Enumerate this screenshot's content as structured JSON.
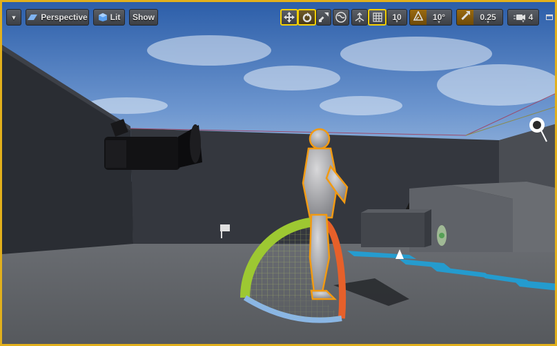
{
  "toolbar": {
    "menu_label": "▾",
    "perspective_label": "Perspective",
    "lit_label": "Lit",
    "show_label": "Show",
    "grid_snap_value": "10",
    "rotation_snap_value": "10°",
    "scale_snap_value": "0.25",
    "camera_speed_value": "4",
    "dropdown_arrow": "▾"
  },
  "colors": {
    "selection_border": "#e2b01c",
    "active_tool_border": "#f5d000",
    "snap_active": "#9a6a10"
  },
  "icons": {
    "menu": "chevron-down-icon",
    "perspective": "perspective-icon",
    "lit": "lit-sphere-icon",
    "translate": "translate-icon",
    "rotate": "rotate-icon",
    "scale": "scale-icon",
    "world": "world-space-icon",
    "surface_snap": "surface-snap-icon",
    "grid_snap": "grid-icon",
    "rotation_snap": "angle-icon",
    "scale_snap": "scale-arrow-icon",
    "camera_speed": "camera-icon",
    "maximize": "maximize-icon"
  }
}
